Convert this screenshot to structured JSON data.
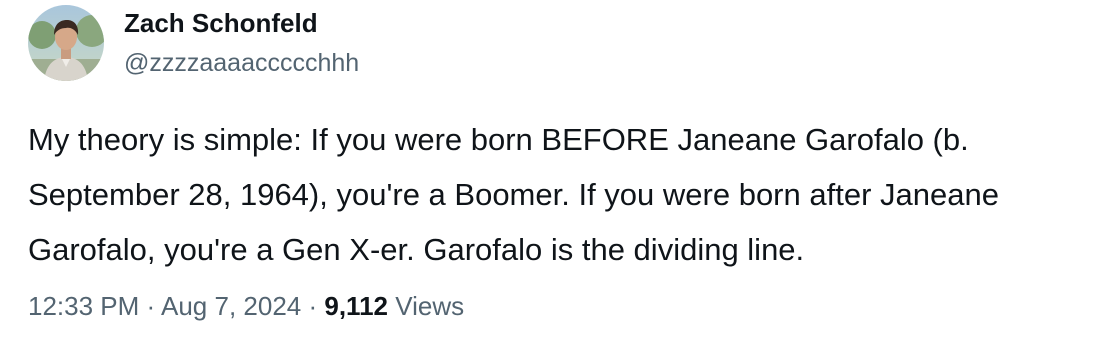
{
  "author": {
    "display_name": "Zach Schonfeld",
    "handle": "@zzzzaaaaccccchhh"
  },
  "tweet": {
    "text": "My theory is simple: If you were born BEFORE Janeane Garofalo (b. September 28, 1964), you're a Boomer. If you were born after Janeane Garofalo, you're a Gen X-er. Garofalo is the dividing line.",
    "time": "12:33 PM",
    "separator": "·",
    "date": "Aug 7, 2024",
    "views_count": "9,112",
    "views_label": "Views"
  },
  "colors": {
    "text_primary": "#0f1419",
    "text_secondary": "#536471",
    "background": "#ffffff"
  },
  "icons": {
    "avatar": "profile-photo"
  }
}
